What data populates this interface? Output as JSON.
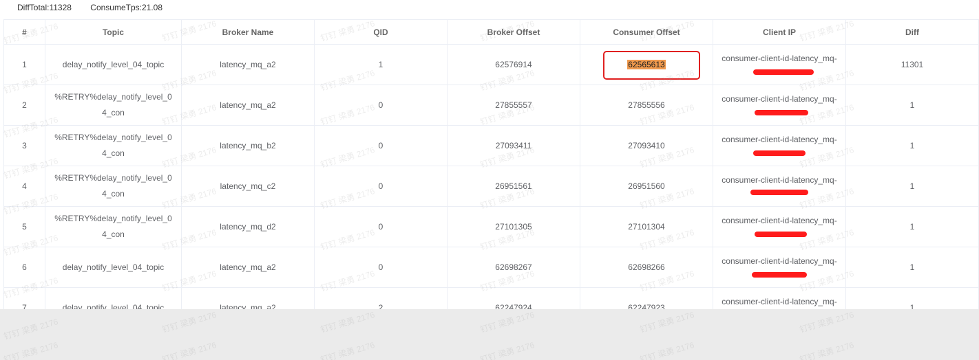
{
  "stats": {
    "diff_total": "DiffTotal:11328",
    "consume_tps": "ConsumeTps:21.08"
  },
  "table": {
    "headers": [
      "#",
      "Topic",
      "Broker Name",
      "QID",
      "Broker Offset",
      "Consumer Offset",
      "Client IP",
      "Diff"
    ],
    "rows": [
      {
        "idx": "1",
        "topic": "delay_notify_level_04_topic",
        "broker": "latency_mq_a2",
        "qid": "1",
        "broker_offset": "62576914",
        "consumer_offset": "62565613",
        "client_ip": "consumer-client-id-latency_mq-",
        "diff": "11301"
      },
      {
        "idx": "2",
        "topic": "%RETRY%delay_notify_level_04_con",
        "broker": "latency_mq_a2",
        "qid": "0",
        "broker_offset": "27855557",
        "consumer_offset": "27855556",
        "client_ip": "consumer-client-id-latency_mq-",
        "diff": "1"
      },
      {
        "idx": "3",
        "topic": "%RETRY%delay_notify_level_04_con",
        "broker": "latency_mq_b2",
        "qid": "0",
        "broker_offset": "27093411",
        "consumer_offset": "27093410",
        "client_ip": "consumer-client-id-latency_mq-",
        "diff": "1"
      },
      {
        "idx": "4",
        "topic": "%RETRY%delay_notify_level_04_con",
        "broker": "latency_mq_c2",
        "qid": "0",
        "broker_offset": "26951561",
        "consumer_offset": "26951560",
        "client_ip": "consumer-client-id-latency_mq-",
        "diff": "1"
      },
      {
        "idx": "5",
        "topic": "%RETRY%delay_notify_level_04_con",
        "broker": "latency_mq_d2",
        "qid": "0",
        "broker_offset": "27101305",
        "consumer_offset": "27101304",
        "client_ip": "consumer-client-id-latency_mq-",
        "diff": "1"
      },
      {
        "idx": "6",
        "topic": "delay_notify_level_04_topic",
        "broker": "latency_mq_a2",
        "qid": "0",
        "broker_offset": "62698267",
        "consumer_offset": "62698266",
        "client_ip": "consumer-client-id-latency_mq-",
        "diff": "1"
      },
      {
        "idx": "7",
        "topic": "delay_notify_level_04_topic",
        "broker": "latency_mq_a2",
        "qid": "2",
        "broker_offset": "62247924",
        "consumer_offset": "62247923",
        "client_ip": "consumer-client-id-latency_mq-",
        "diff": "1"
      }
    ]
  },
  "watermark": "钉钉 梁勇 2176",
  "colors": {
    "redaction": "#ff1c1c",
    "highlight": "#f09a4e",
    "focus_box": "#e02020",
    "border": "#ebeef5"
  }
}
